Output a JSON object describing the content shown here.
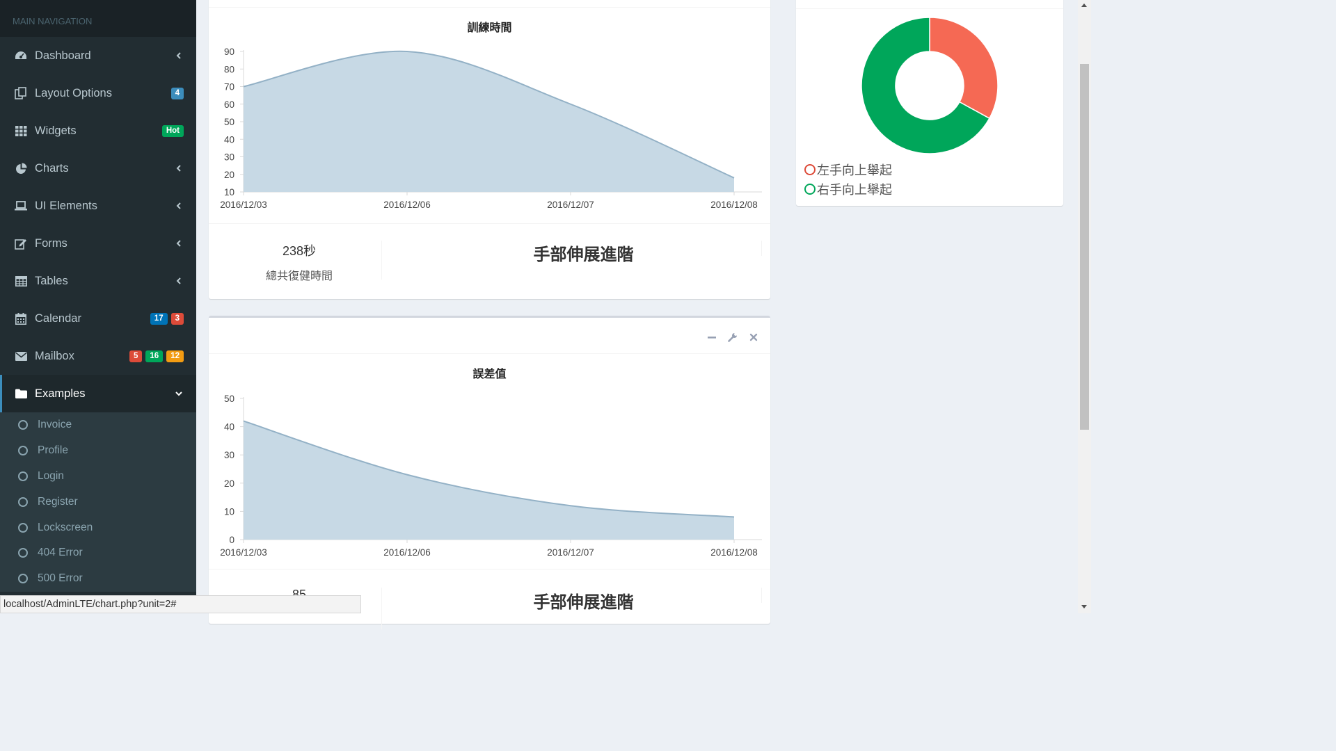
{
  "sidebar": {
    "header": "MAIN NAVIGATION",
    "items": [
      {
        "label": "Dashboard"
      },
      {
        "label": "Layout Options",
        "badges": [
          "4"
        ]
      },
      {
        "label": "Widgets",
        "badges": [
          "Hot"
        ]
      },
      {
        "label": "Charts"
      },
      {
        "label": "UI Elements"
      },
      {
        "label": "Forms"
      },
      {
        "label": "Tables"
      },
      {
        "label": "Calendar",
        "badges": [
          "17",
          "3"
        ]
      },
      {
        "label": "Mailbox",
        "badges": [
          "5",
          "16",
          "12"
        ]
      },
      {
        "label": "Examples"
      }
    ],
    "subitems": [
      "Invoice",
      "Profile",
      "Login",
      "Register",
      "Lockscreen",
      "404 Error",
      "500 Error"
    ],
    "badge_colors": {
      "blue": "#3c8dbc",
      "green": "#00a65a",
      "red": "#dd4b39",
      "sky": "#0073b7",
      "orange": "#f39c12"
    }
  },
  "panel1": {
    "stat_value": "238秒",
    "stat_label": "總共復健時間",
    "exercise_title": "手部伸展進階"
  },
  "panel2": {
    "stat_value": "85",
    "exercise_title": "手部伸展進階"
  },
  "statusbar": "localhost/AdminLTE/chart.php?unit=2#",
  "chart_data": [
    {
      "type": "area",
      "title": "訓練時間",
      "x": [
        "2016/12/03",
        "2016/12/06",
        "2016/12/07",
        "2016/12/08"
      ],
      "values": [
        70,
        90,
        60,
        18
      ],
      "ylim": [
        10,
        90
      ],
      "yticks": [
        10,
        20,
        30,
        40,
        50,
        60,
        70,
        80,
        90
      ],
      "color": "#c7d9e5",
      "line_color": "#93b1c6"
    },
    {
      "type": "area",
      "title": "誤差值",
      "x": [
        "2016/12/03",
        "2016/12/06",
        "2016/12/07",
        "2016/12/08"
      ],
      "values": [
        42,
        23,
        12,
        8
      ],
      "ylim": [
        0,
        50
      ],
      "yticks": [
        0,
        10,
        20,
        30,
        40,
        50
      ],
      "color": "#c7d9e5",
      "line_color": "#93b1c6"
    },
    {
      "type": "pie",
      "donut": true,
      "labels": [
        "左手向上舉起",
        "右手向上舉起"
      ],
      "values": [
        33,
        67
      ],
      "colors": [
        "#f56954",
        "#00a65a"
      ]
    }
  ]
}
